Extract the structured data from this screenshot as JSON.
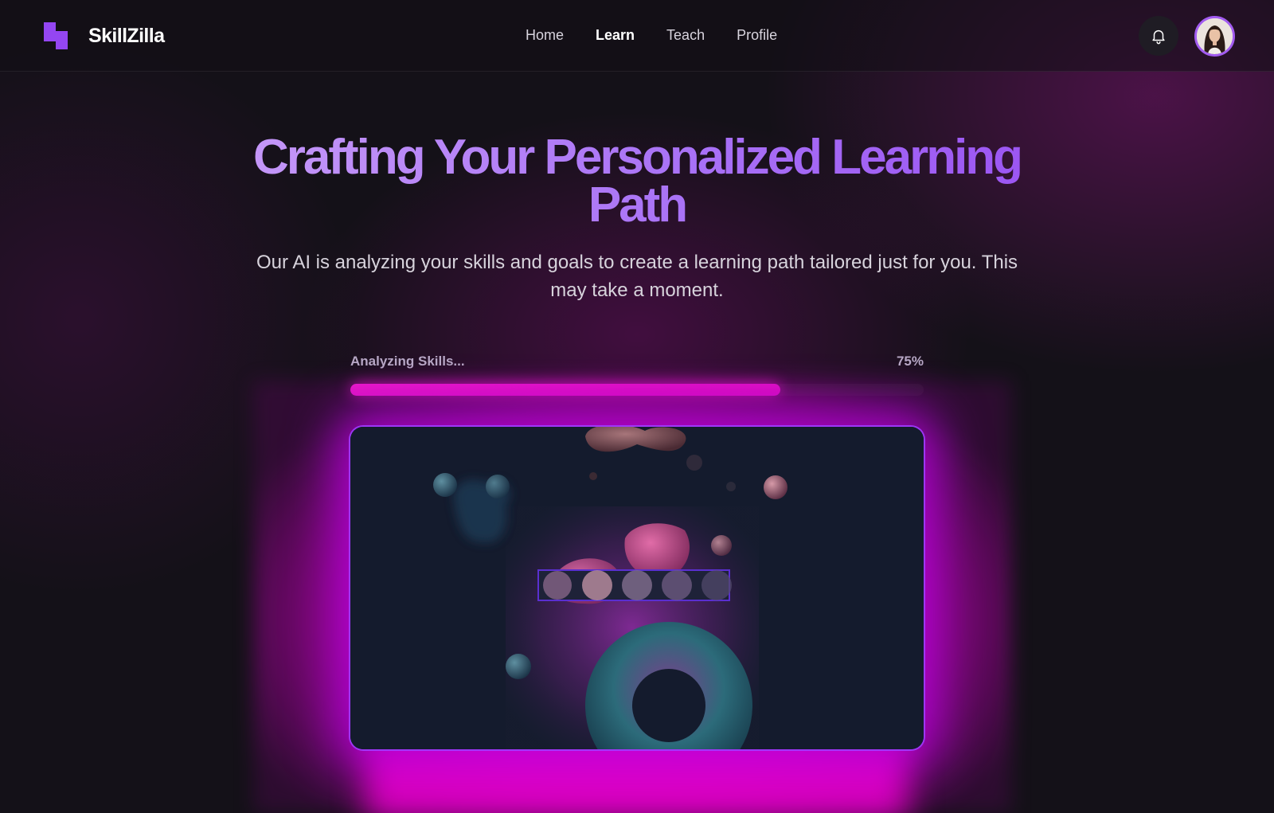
{
  "brand": {
    "name": "SkillZilla"
  },
  "nav": {
    "items": [
      {
        "label": "Home",
        "active": false
      },
      {
        "label": "Learn",
        "active": true
      },
      {
        "label": "Teach",
        "active": false
      },
      {
        "label": "Profile",
        "active": false
      }
    ]
  },
  "header": {
    "bell_icon": "bell-icon",
    "avatar": "user-avatar"
  },
  "hero": {
    "title": "Crafting Your Personalized Learning Path",
    "subtitle": "Our AI is analyzing your skills and goals to create a learning path tailored just for you. This may take a moment."
  },
  "progress": {
    "label": "Analyzing Skills...",
    "percent_text": "75%",
    "value": 0.75
  },
  "colors": {
    "accent": "#9446f2",
    "title_gradient_start": "#c79bf8",
    "title_gradient_end": "#9a52f2",
    "progress_fill": "#ff1ed8",
    "glow": "#e60ac8",
    "background": "#141118"
  }
}
